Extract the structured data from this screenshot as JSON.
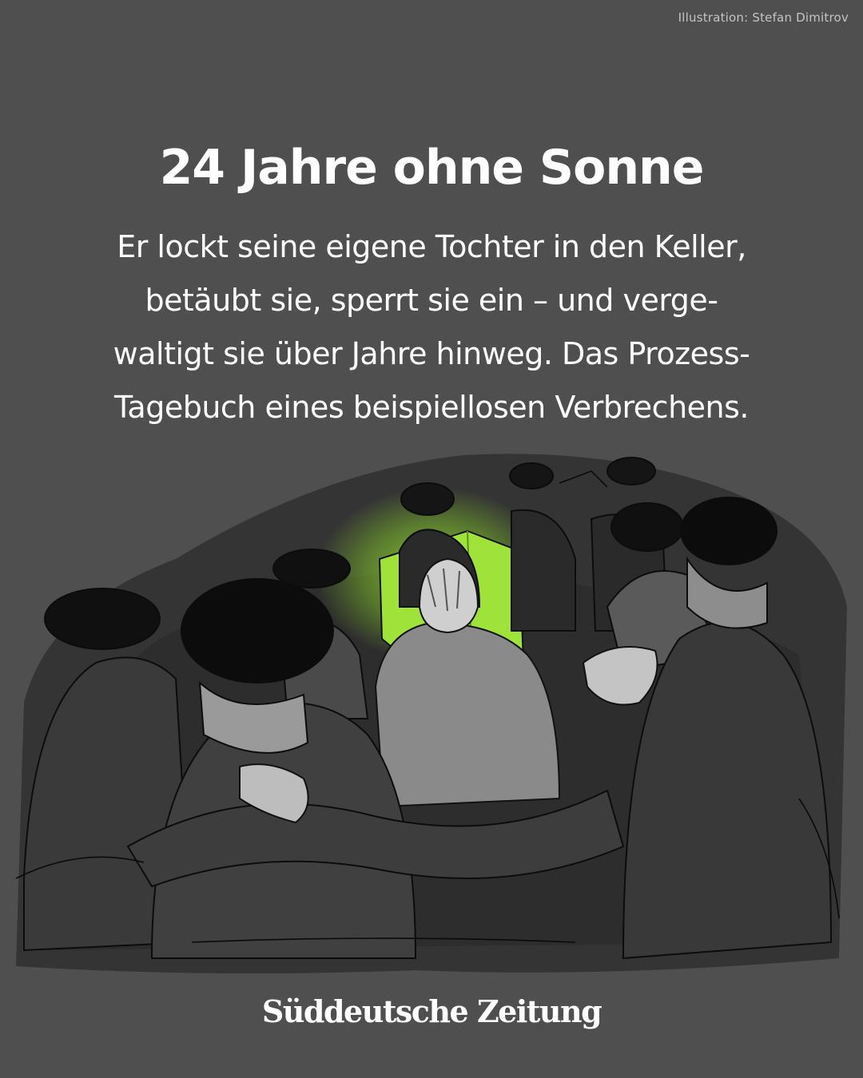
{
  "credit": "Illustration: Stefan Dimitrov",
  "headline": "24 Jahre ohne Sonne",
  "dek": {
    "lines": [
      "Er lockt seine eigene Tochter in den Keller,",
      "betäubt sie, sperrt sie ein – und verge-",
      "waltigt sie über Jahre hinweg. Das Prozess-",
      "Tagebuch eines beispiellosen Verbrechens."
    ]
  },
  "logo": "Süddeutsche Zeitung",
  "illustration": {
    "subject": "courtroom-crowd-with-green-folder",
    "accent_color": "#9fe23a",
    "background_color": "#4f4f4f",
    "ink_color": "#111111"
  }
}
